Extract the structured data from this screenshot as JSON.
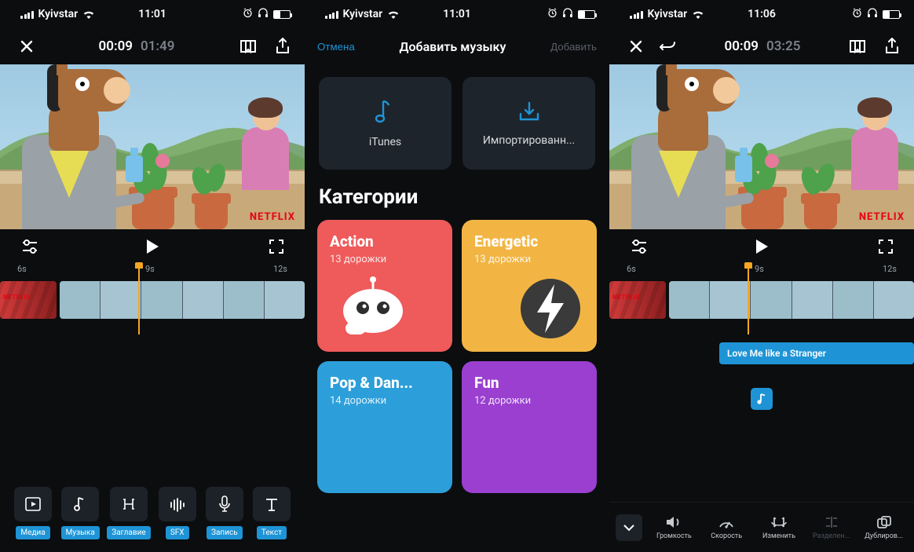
{
  "screen1": {
    "status": {
      "carrier": "Kyivstar",
      "time": "11:01"
    },
    "topbar": {
      "current": "00:09",
      "total": "01:49"
    },
    "ruler": [
      "6s",
      "9s",
      "12s"
    ],
    "netflix": "NETFLIX",
    "clip_netflix": "NETFLIX",
    "tools": [
      {
        "label": "Медиа"
      },
      {
        "label": "Музыка"
      },
      {
        "label": "Заглавие"
      },
      {
        "label": "SFX"
      },
      {
        "label": "Запись"
      },
      {
        "label": "Текст"
      }
    ]
  },
  "screen2": {
    "status": {
      "carrier": "Kyivstar",
      "time": "11:01"
    },
    "nav": {
      "cancel": "Отмена",
      "title": "Добавить музыку",
      "add": "Добавить"
    },
    "sources": {
      "itunes": "iTunes",
      "imported": "Импортированн..."
    },
    "cat_header": "Категории",
    "cards": {
      "action": {
        "title": "Action",
        "sub": "13 дорожки"
      },
      "energetic": {
        "title": "Energetic",
        "sub": "13 дорожки"
      },
      "pop": {
        "title": "Pop & Dan...",
        "sub": "14 дорожки"
      },
      "fun": {
        "title": "Fun",
        "sub": "12 дорожки"
      }
    }
  },
  "screen3": {
    "status": {
      "carrier": "Kyivstar",
      "time": "11:06"
    },
    "topbar": {
      "current": "00:09",
      "total": "03:25"
    },
    "ruler": [
      "6s",
      "9s",
      "12s"
    ],
    "netflix": "NETFLIX",
    "clip_netflix": "NETFLIX",
    "audio_title": "Love Me like a Stranger",
    "bottom": [
      {
        "label": "Громкость"
      },
      {
        "label": "Скорость"
      },
      {
        "label": "Изменить"
      },
      {
        "label": "Разделен..."
      },
      {
        "label": "Дублиров..."
      }
    ]
  }
}
